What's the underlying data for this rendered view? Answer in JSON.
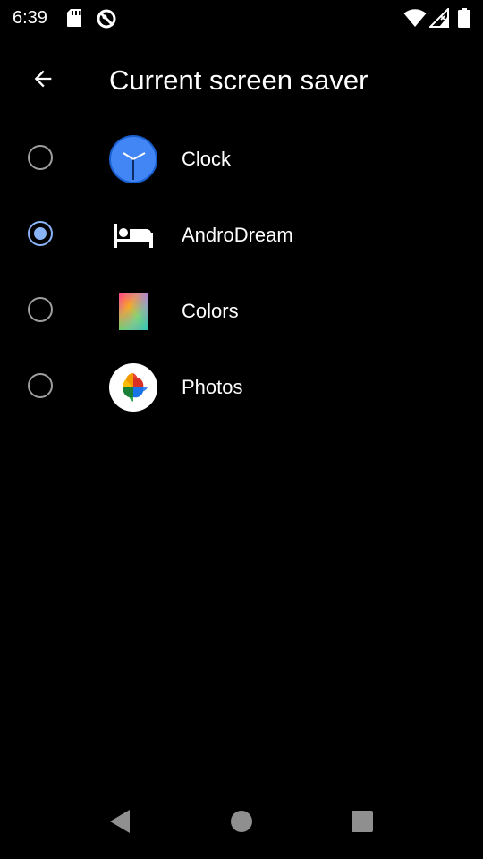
{
  "status_bar": {
    "time": "6:39",
    "left_icons": [
      "sd-card-icon",
      "do-not-disturb-icon"
    ],
    "right_icons": [
      "wifi-icon",
      "cellular-signal-icon",
      "battery-icon"
    ]
  },
  "app_bar": {
    "back_icon": "arrow-back-icon",
    "title": "Current screen saver"
  },
  "options": [
    {
      "label": "Clock",
      "icon": "clock-icon",
      "selected": false
    },
    {
      "label": "AndroDream",
      "icon": "bed-icon",
      "selected": true
    },
    {
      "label": "Colors",
      "icon": "colors-gradient-icon",
      "selected": false
    },
    {
      "label": "Photos",
      "icon": "google-photos-icon",
      "selected": false
    }
  ],
  "nav_bar": {
    "icons": [
      "nav-back-icon",
      "nav-home-icon",
      "nav-recents-icon"
    ]
  },
  "colors": {
    "background": "#000000",
    "accent": "#8ab4f8",
    "radio_unchecked": "#9e9e9e",
    "text": "#ffffff"
  }
}
